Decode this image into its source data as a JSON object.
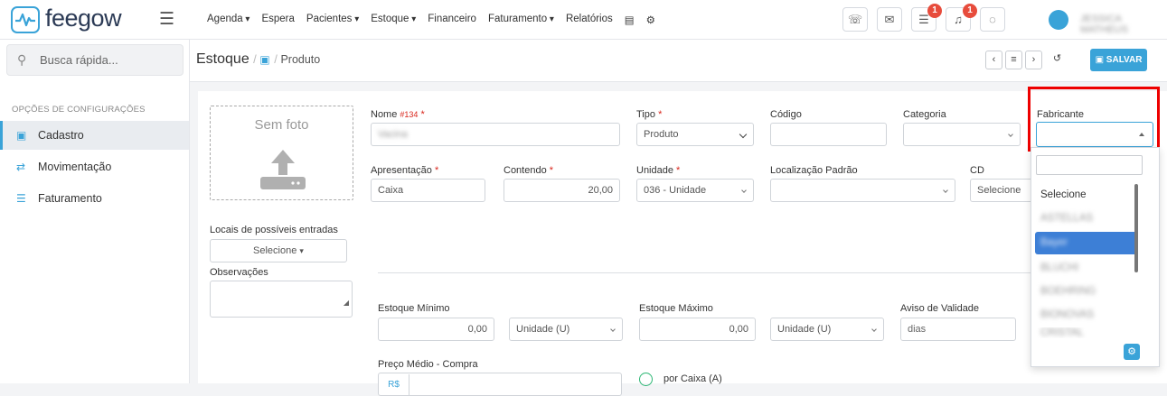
{
  "brand": {
    "name": "feegow"
  },
  "nav": {
    "items": [
      "Agenda",
      "Espera",
      "Pacientes",
      "Estoque",
      "Financeiro",
      "Faturamento",
      "Relatórios"
    ]
  },
  "topbar": {
    "notif_tasks": "1",
    "notif_bell": "1"
  },
  "sidebar": {
    "search_placeholder": "Busca rápida...",
    "section": "OPÇÕES DE CONFIGURAÇÕES",
    "items": [
      {
        "label": "Cadastro"
      },
      {
        "label": "Movimentação"
      },
      {
        "label": "Faturamento"
      }
    ]
  },
  "page": {
    "title": "Estoque",
    "sub": "Produto",
    "save": "SALVAR"
  },
  "photo": {
    "label": "Sem foto"
  },
  "form": {
    "nome_label": "Nome",
    "nome_tag": "#134",
    "nome_value": "Vacina",
    "tipo_label": "Tipo",
    "tipo_value": "Produto",
    "codigo_label": "Código",
    "categoria_label": "Categoria",
    "fabricante_label": "Fabricante",
    "apresentacao_label": "Apresentação",
    "apresentacao_value": "Caixa",
    "contendo_label": "Contendo",
    "contendo_value": "20,00",
    "unidade_label": "Unidade",
    "unidade_value": "036 - Unidade",
    "localizacao_label": "Localização Padrão",
    "cd_label": "CD",
    "cd_value": "Selecione",
    "locais_label": "Locais de possíveis entradas",
    "locais_value": "Selecione",
    "obs_label": "Observações",
    "est_min_label": "Estoque Mínimo",
    "est_min_value": "0,00",
    "est_min_unit": "Unidade (U)",
    "est_max_label": "Estoque Máximo",
    "est_max_value": "0,00",
    "est_max_unit": "Unidade (U)",
    "aviso_label": "Aviso de Validade",
    "aviso_placeholder": "dias",
    "preco_label": "Preço Médio - Compra",
    "preco_prefix": "R$",
    "por_caixa_label": "por Caixa (A)"
  },
  "dropdown": {
    "options": [
      "Selecione",
      "ASTELLAS",
      "Bayer",
      "BLUCHI",
      "BOEHRING",
      "BIONOVAS",
      "CRISTAL"
    ],
    "highlighted_index": 2
  },
  "user": {
    "name": "JESSICA MATHEUS"
  },
  "colors": {
    "accent": "#3aa3d8",
    "required": "#d9261c",
    "badge": "#e74c3c",
    "highlight": "#3d7fd6",
    "annotation": "#e00000"
  }
}
